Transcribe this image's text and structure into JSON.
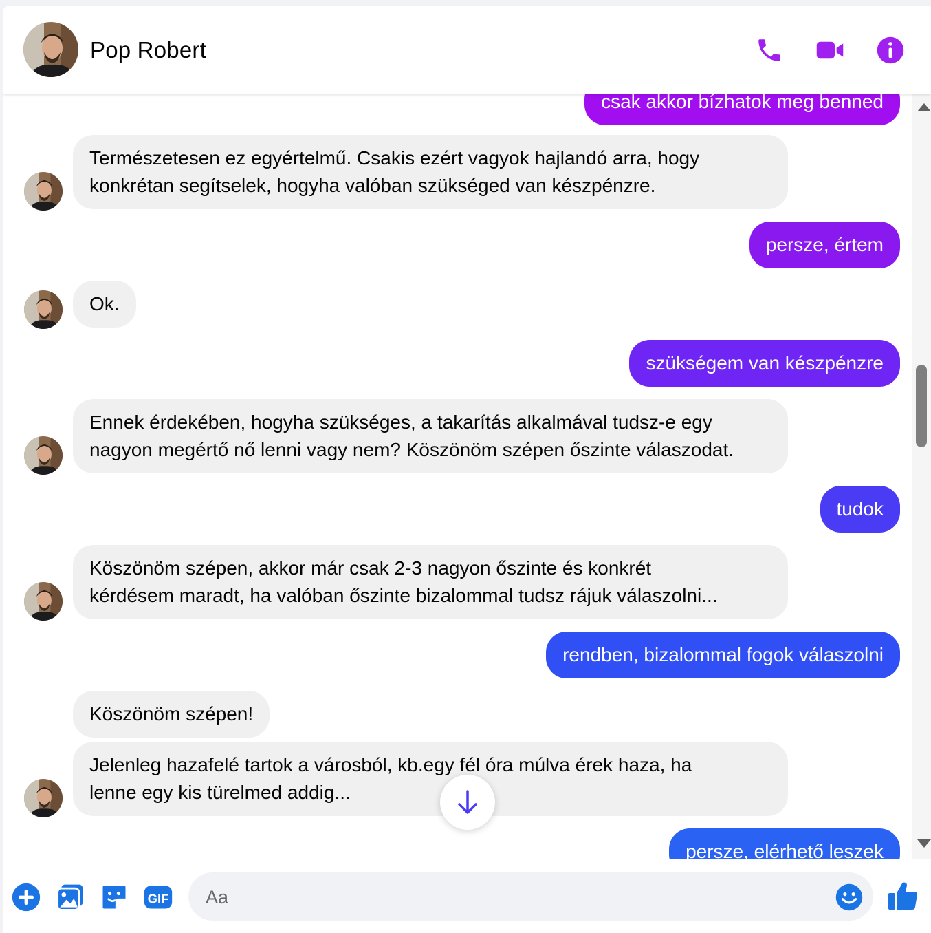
{
  "header": {
    "contact_name": "Pop Robert",
    "icons": [
      "phone-icon",
      "video-camera-icon",
      "info-icon"
    ]
  },
  "colors": {
    "accent": "#a020f0",
    "incoming_bubble": "#f0f0f0",
    "outgoing_gradient": [
      "#a10ff0",
      "#8a19f0",
      "#6f26f5",
      "#5e2cf6",
      "#4a3bf5",
      "#3050f5",
      "#2a62f4"
    ],
    "footer_icon": "#1b74e4"
  },
  "messages": [
    {
      "from": "me",
      "text": "csak akkor bízhatok meg benned"
    },
    {
      "from": "them",
      "text_lines": [
        "Természetesen ez egyértelmű. Csakis ezért vagyok hajlandó arra, hogy",
        "konkrétan segítselek, hogyha valóban szükséged van készpénzre."
      ]
    },
    {
      "from": "me",
      "text": "persze, értem"
    },
    {
      "from": "them",
      "text_lines": [
        "Ok."
      ]
    },
    {
      "from": "me",
      "text": "szükségem van készpénzre"
    },
    {
      "from": "them",
      "text_lines": [
        "Ennek érdekében, hogyha szükséges,  a takarítás alkalmával tudsz-e egy",
        "nagyon megértő nő lenni vagy nem? Köszönöm szépen őszinte válaszodat."
      ]
    },
    {
      "from": "me",
      "text": "tudok"
    },
    {
      "from": "them",
      "text_lines": [
        "Köszönöm szépen, akkor már csak 2-3 nagyon őszinte és konkrét",
        "kérdésem maradt, ha valóban őszinte bizalommal tudsz rájuk válaszolni..."
      ]
    },
    {
      "from": "me",
      "text": "rendben, bizalommal fogok válaszolni"
    },
    {
      "from": "them",
      "text_lines": [
        "Köszönöm szépen!"
      ]
    },
    {
      "from": "them",
      "text_lines": [
        "Jelenleg hazafelé tartok a városból, kb.egy fél óra múlva érek haza, ha",
        "lenne egy kis türelmed addig..."
      ]
    },
    {
      "from": "me",
      "text": "persze, elérhető leszek"
    }
  ],
  "composer": {
    "placeholder": "Aa",
    "icons": [
      "plus-icon",
      "image-icon",
      "sticker-icon",
      "gif-icon",
      "emoji-icon",
      "thumbs-up-icon"
    ],
    "gif_label": "GIF"
  }
}
